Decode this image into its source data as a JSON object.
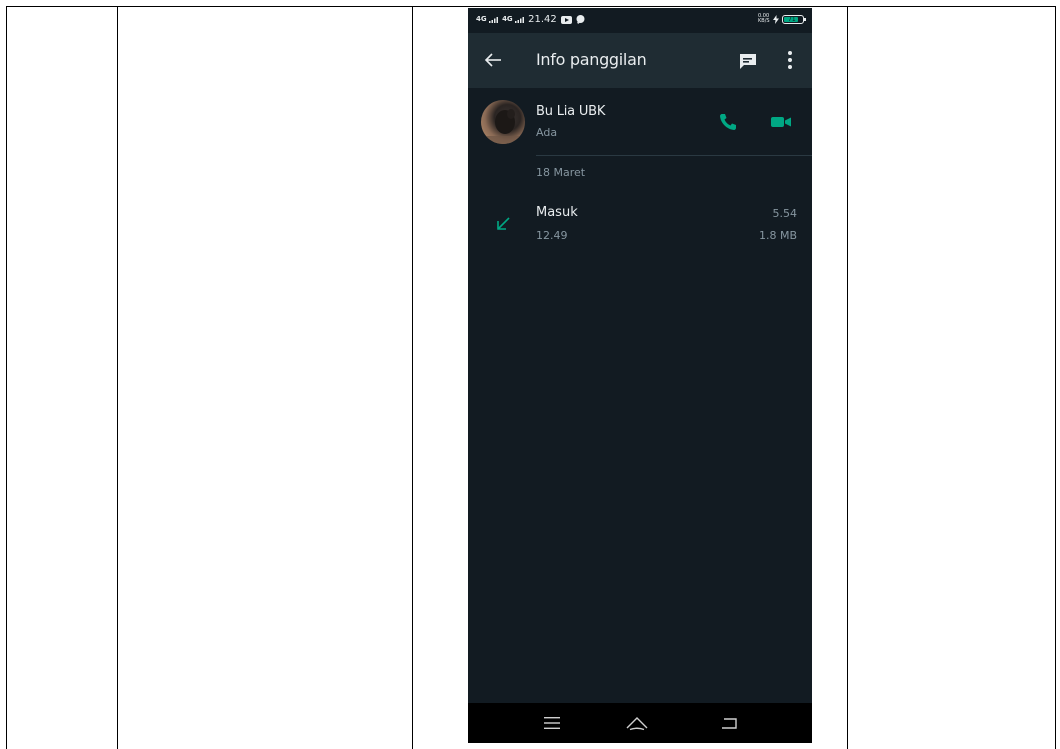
{
  "status_bar": {
    "signal_1": "4G",
    "signal_2": "4G",
    "time": "21.42",
    "net_speed": "0.00 KB/S",
    "battery": "71"
  },
  "toolbar": {
    "title": "Info panggilan"
  },
  "contact": {
    "name": "Bu Lia UBK",
    "status": "Ada"
  },
  "calls": {
    "date": "18 Maret",
    "entries": [
      {
        "type": "Masuk",
        "time": "12.49",
        "duration": "5.54",
        "size": "1.8 MB"
      }
    ]
  },
  "colors": {
    "background": "#121b22",
    "toolbar": "#1f2c33",
    "accent": "#00a884",
    "primary_text": "#e9edef",
    "secondary_text": "#8696a0"
  },
  "icons": {
    "back": "arrow-left-icon",
    "message": "message-icon",
    "more": "more-vertical-icon",
    "call": "phone-icon",
    "video": "video-camera-icon",
    "incoming": "incoming-arrow-icon",
    "nav_menu": "menu-icon",
    "nav_home": "home-icon",
    "nav_back": "back-icon"
  }
}
